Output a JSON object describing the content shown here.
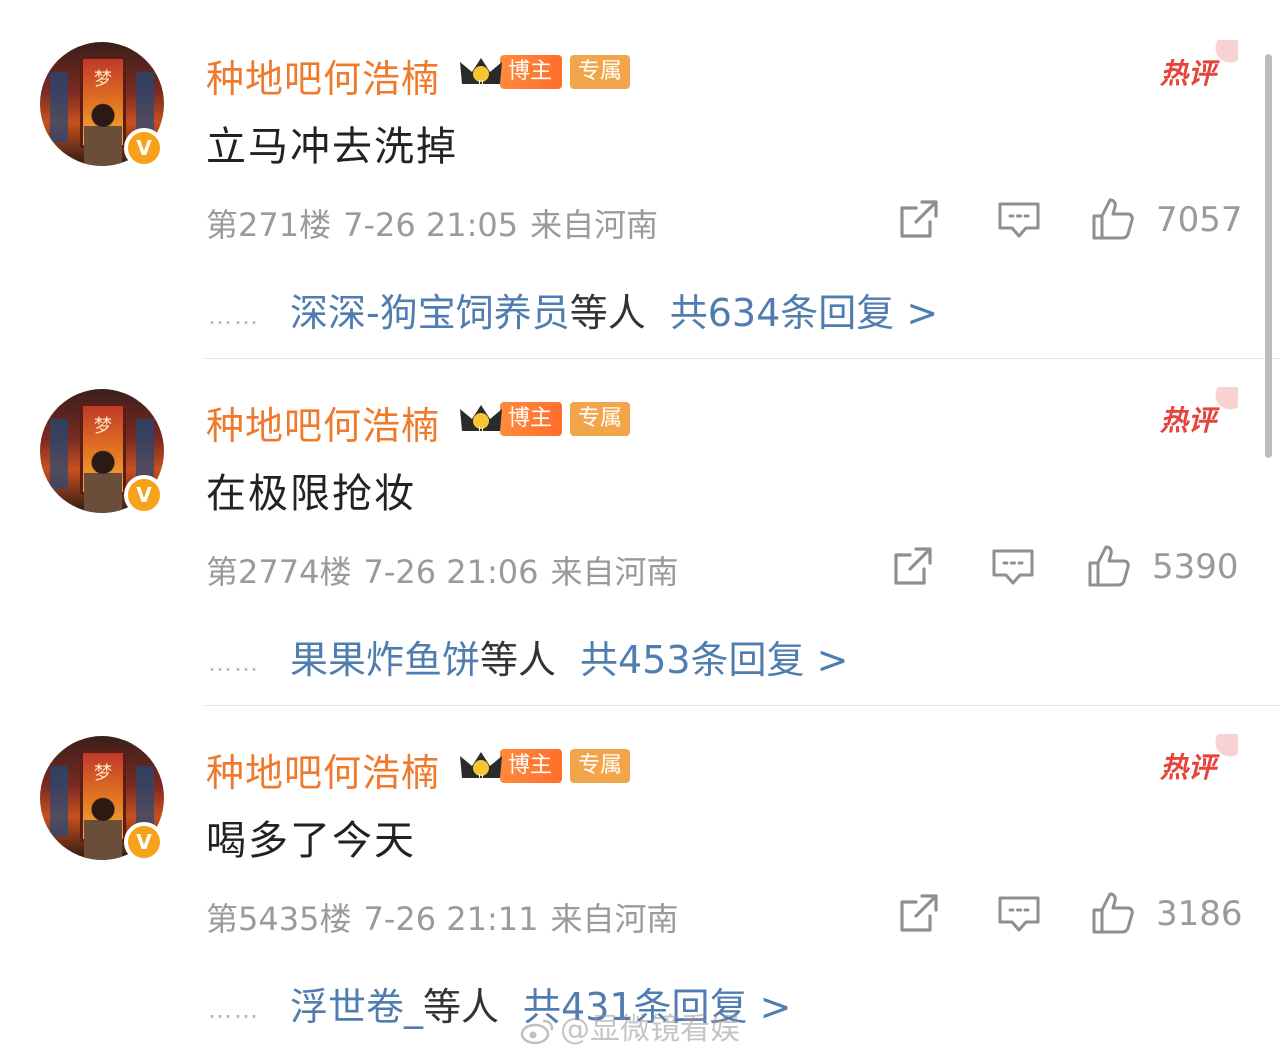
{
  "colors": {
    "username": "#f07a2c",
    "link": "#507daf",
    "meta": "#9a9a9a",
    "hot": "#e8433a",
    "blogger_pill": "#ff7a33",
    "exclusive_pill": "#f2a54a"
  },
  "comments": [
    {
      "username": "种地吧何浩楠",
      "avatar_icon": "avatar-icon",
      "verified_badge": "V",
      "crown_icon": "crown-icon",
      "blogger_label": "博主",
      "exclusive_label": "专属",
      "hot_label": "热评",
      "content": "立马冲去洗掉",
      "floor": "第271楼",
      "datetime": "7-26 21:05",
      "location": "来自河南",
      "like_count": "7057",
      "reply_dots": "……",
      "reply_users": "深深-狗宝饲养员",
      "reply_etc": "等人",
      "reply_total": "共634条回复 >"
    },
    {
      "username": "种地吧何浩楠",
      "avatar_icon": "avatar-icon",
      "verified_badge": "V",
      "crown_icon": "crown-icon",
      "blogger_label": "博主",
      "exclusive_label": "专属",
      "hot_label": "热评",
      "content": "在极限抢妆",
      "floor": "第2774楼",
      "datetime": "7-26 21:06",
      "location": "来自河南",
      "like_count": "5390",
      "reply_dots": "……",
      "reply_users": "果果炸鱼饼",
      "reply_etc": "等人",
      "reply_total": "共453条回复 >"
    },
    {
      "username": "种地吧何浩楠",
      "avatar_icon": "avatar-icon",
      "verified_badge": "V",
      "crown_icon": "crown-icon",
      "blogger_label": "博主",
      "exclusive_label": "专属",
      "hot_label": "热评",
      "content": "喝多了今天",
      "floor": "第5435楼",
      "datetime": "7-26 21:11",
      "location": "来自河南",
      "like_count": "3186",
      "reply_dots": "……",
      "reply_users": "浮世卷_",
      "reply_etc": "等人",
      "reply_total": "共431条回复 >"
    }
  ],
  "watermark": {
    "icon": "weibo-icon",
    "text": "@显微镜看娱"
  }
}
